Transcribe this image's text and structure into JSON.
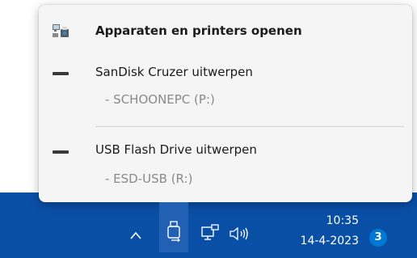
{
  "menu": {
    "items": [
      {
        "label": "Apparaten en printers openen",
        "icon": "devices-printers-icon"
      },
      {
        "label": "SanDisk Cruzer uitwerpen",
        "sublabel": "- SCHOONEPC (P:)",
        "icon": "usb-drive-icon"
      },
      {
        "label": "USB Flash Drive uitwerpen",
        "sublabel": "- ESD-USB (R:)",
        "icon": "usb-drive-icon"
      }
    ]
  },
  "taskbar": {
    "background": "#0a4fa6",
    "time": "10:35",
    "date": "14-4-2023",
    "notification_count": "3",
    "icons": [
      "chevron-up-icon",
      "usb-eject-icon",
      "network-icon",
      "volume-icon"
    ]
  }
}
